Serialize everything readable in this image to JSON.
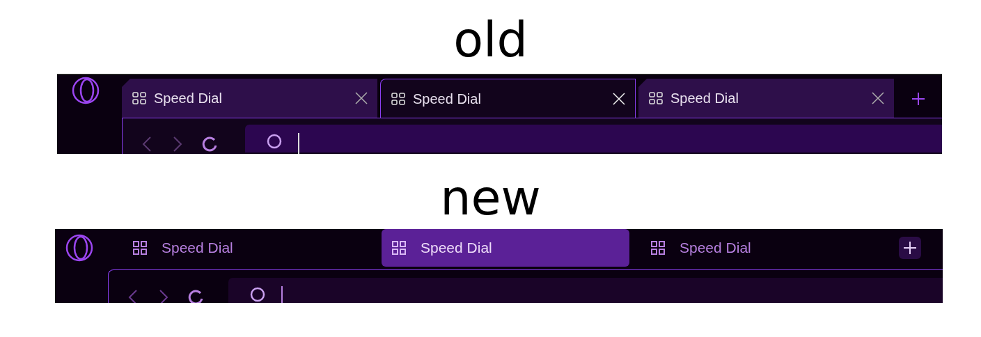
{
  "sections": [
    {
      "heading": "old",
      "kind": "classic",
      "tabs": [
        {
          "label": "Speed Dial",
          "selected": false
        },
        {
          "label": "Speed Dial",
          "selected": true
        },
        {
          "label": "Speed Dial",
          "selected": false
        }
      ]
    },
    {
      "heading": "new",
      "kind": "modern",
      "tabs": [
        {
          "label": "Speed Dial",
          "selected": false
        },
        {
          "label": "Speed Dial",
          "selected": true
        },
        {
          "label": "Speed Dial",
          "selected": false
        }
      ]
    }
  ]
}
